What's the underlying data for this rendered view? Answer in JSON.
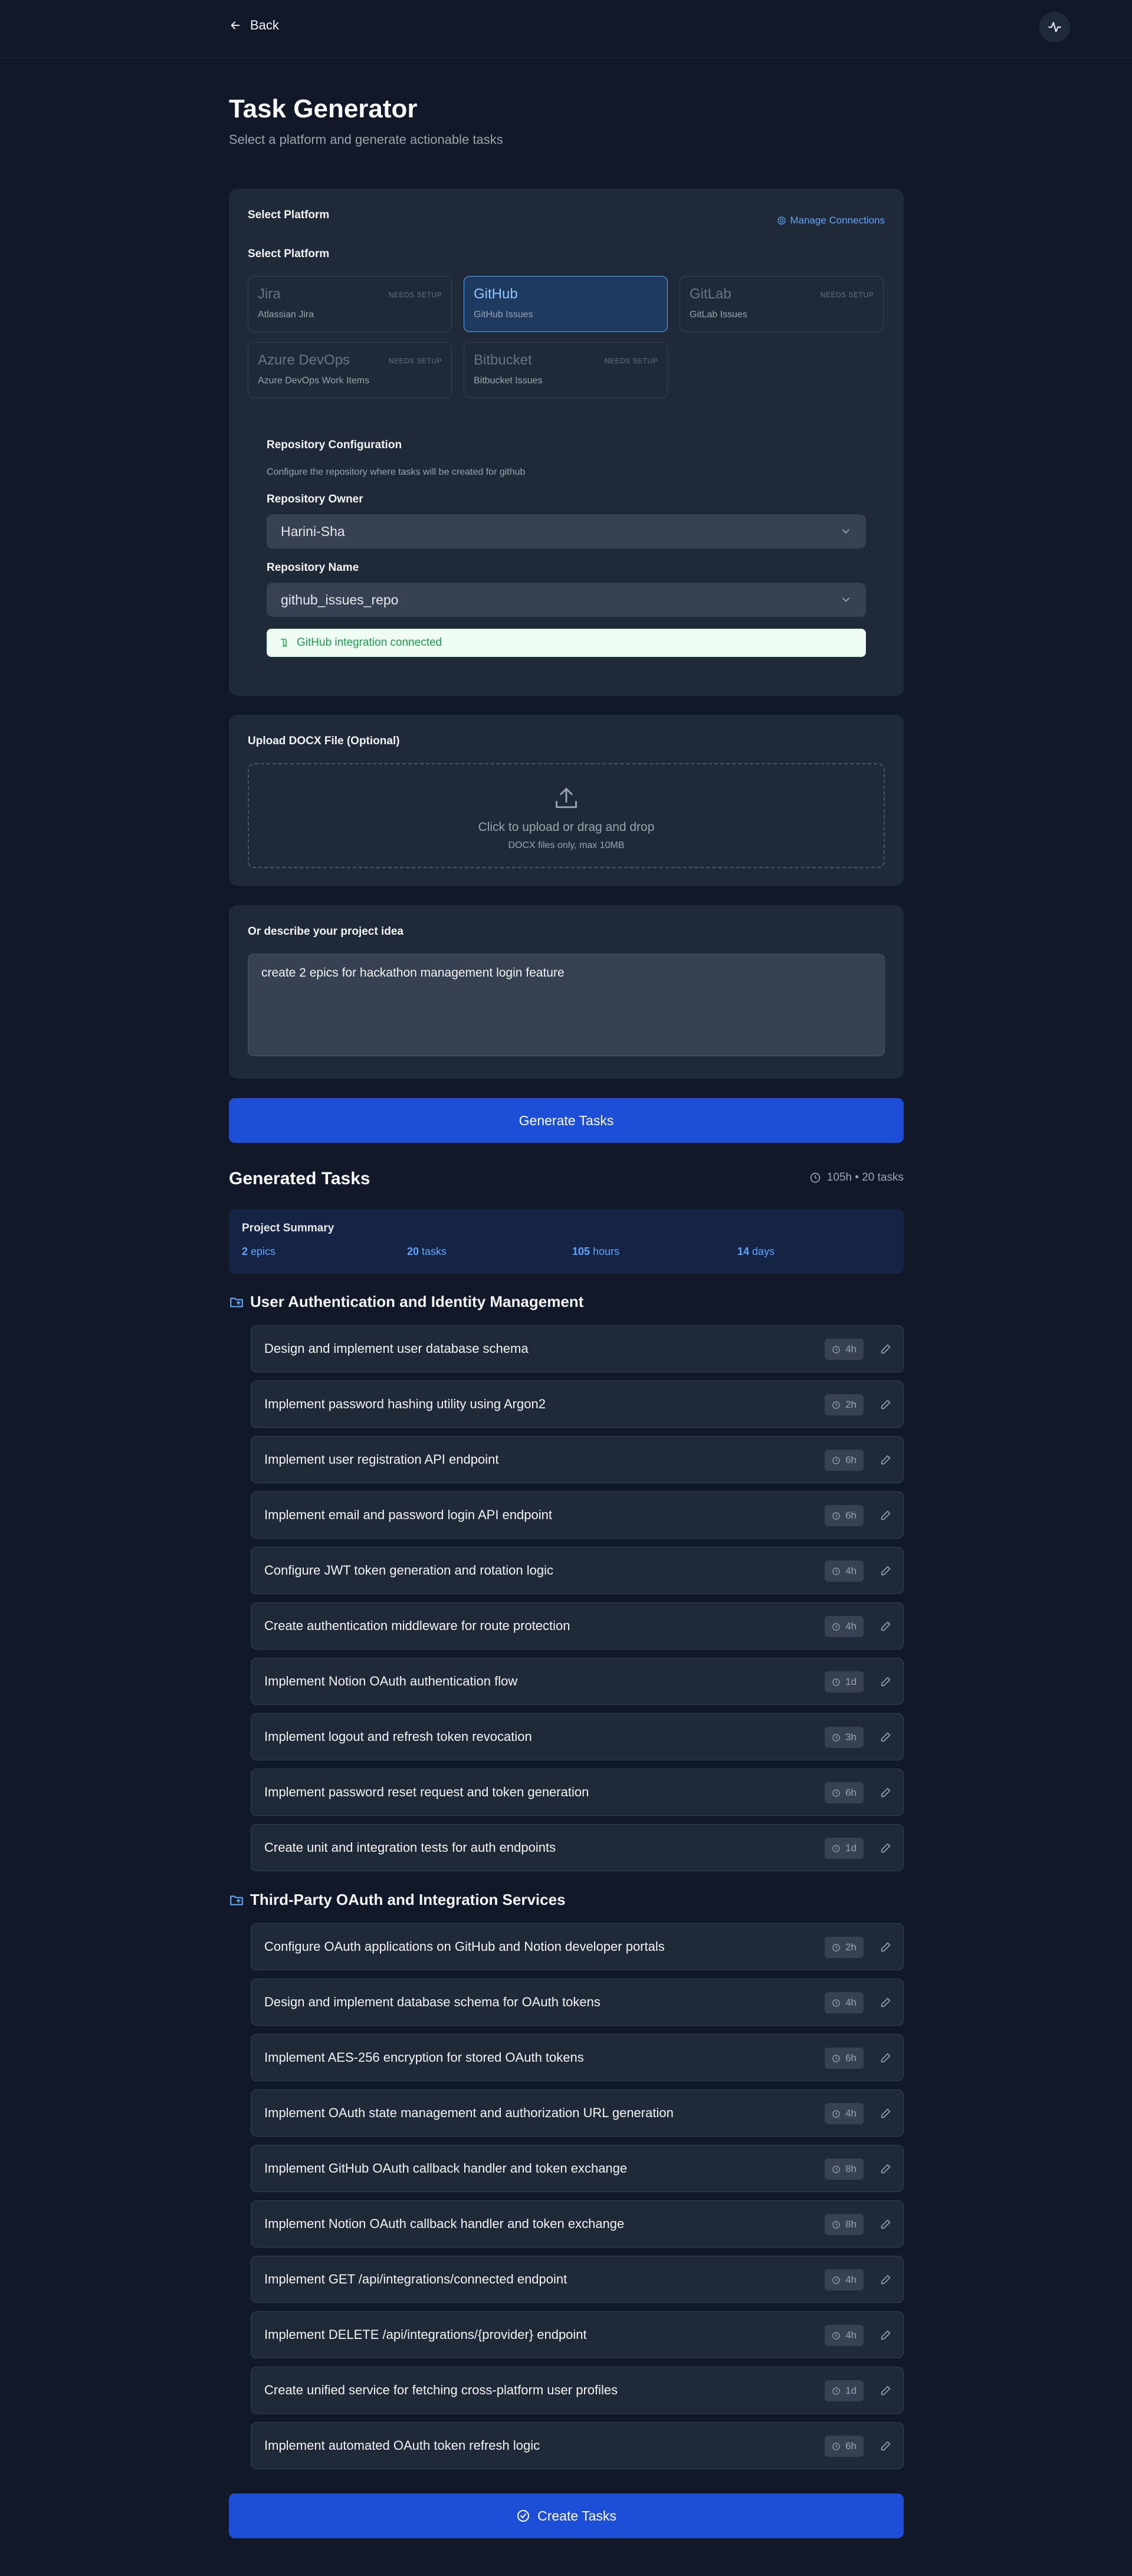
{
  "nav": {
    "back_label": "Back"
  },
  "header": {
    "title": "Task Generator",
    "subtitle": "Select a platform and generate actionable tasks"
  },
  "platform_card": {
    "label": "Select Platform",
    "manage_label": "Manage Connections",
    "inner_label": "Select Platform",
    "platforms": [
      {
        "name": "Jira",
        "sub": "Atlassian Jira",
        "tag": "NEEDS SETUP"
      },
      {
        "name": "GitHub",
        "sub": "GitHub Issues",
        "tag": ""
      },
      {
        "name": "GitLab",
        "sub": "GitLab Issues",
        "tag": "NEEDS SETUP"
      },
      {
        "name": "Azure DevOps",
        "sub": "Azure DevOps Work Items",
        "tag": "NEEDS SETUP"
      },
      {
        "name": "Bitbucket",
        "sub": "Bitbucket Issues",
        "tag": "NEEDS SETUP"
      }
    ],
    "repo": {
      "title": "Repository Configuration",
      "desc": "Configure the repository where tasks will be created for github",
      "owner_label": "Repository Owner",
      "owner_value": "Harini-Sha",
      "name_label": "Repository Name",
      "name_value": "github_issues_repo",
      "status": "GitHub integration connected"
    }
  },
  "upload_card": {
    "label": "Upload DOCX File (Optional)",
    "main_text": "Click to upload or drag and drop",
    "hint": "DOCX files only, max 10MB"
  },
  "describe_card": {
    "label": "Or describe your project idea",
    "value": "create 2 epics for hackathon management login feature"
  },
  "generate_button": "Generate Tasks",
  "results": {
    "title": "Generated Tasks",
    "meta": "105h • 20 tasks",
    "summary_title": "Project Summary",
    "stats": [
      {
        "num": "2",
        "unit": "epics"
      },
      {
        "num": "20",
        "unit": "tasks"
      },
      {
        "num": "105",
        "unit": "hours"
      },
      {
        "num": "14",
        "unit": "days"
      }
    ],
    "epics": [
      {
        "title": "User Authentication and Identity Management",
        "tasks": [
          {
            "name": "Design and implement user database schema",
            "est": "4h"
          },
          {
            "name": "Implement password hashing utility using Argon2",
            "est": "2h"
          },
          {
            "name": "Implement user registration API endpoint",
            "est": "6h"
          },
          {
            "name": "Implement email and password login API endpoint",
            "est": "6h"
          },
          {
            "name": "Configure JWT token generation and rotation logic",
            "est": "4h"
          },
          {
            "name": "Create authentication middleware for route protection",
            "est": "4h"
          },
          {
            "name": "Implement Notion OAuth authentication flow",
            "est": "1d"
          },
          {
            "name": "Implement logout and refresh token revocation",
            "est": "3h"
          },
          {
            "name": "Implement password reset request and token generation",
            "est": "6h"
          },
          {
            "name": "Create unit and integration tests for auth endpoints",
            "est": "1d"
          }
        ]
      },
      {
        "title": "Third-Party OAuth and Integration Services",
        "tasks": [
          {
            "name": "Configure OAuth applications on GitHub and Notion developer portals",
            "est": "2h"
          },
          {
            "name": "Design and implement database schema for OAuth tokens",
            "est": "4h"
          },
          {
            "name": "Implement AES-256 encryption for stored OAuth tokens",
            "est": "6h"
          },
          {
            "name": "Implement OAuth state management and authorization URL generation",
            "est": "4h"
          },
          {
            "name": "Implement GitHub OAuth callback handler and token exchange",
            "est": "8h"
          },
          {
            "name": "Implement Notion OAuth callback handler and token exchange",
            "est": "8h"
          },
          {
            "name": "Implement GET /api/integrations/connected endpoint",
            "est": "4h"
          },
          {
            "name": "Implement DELETE /api/integrations/{provider} endpoint",
            "est": "4h"
          },
          {
            "name": "Create unified service for fetching cross-platform user profiles",
            "est": "1d"
          },
          {
            "name": "Implement automated OAuth token refresh logic",
            "est": "6h"
          }
        ]
      }
    ]
  },
  "create_button": "Create Tasks"
}
